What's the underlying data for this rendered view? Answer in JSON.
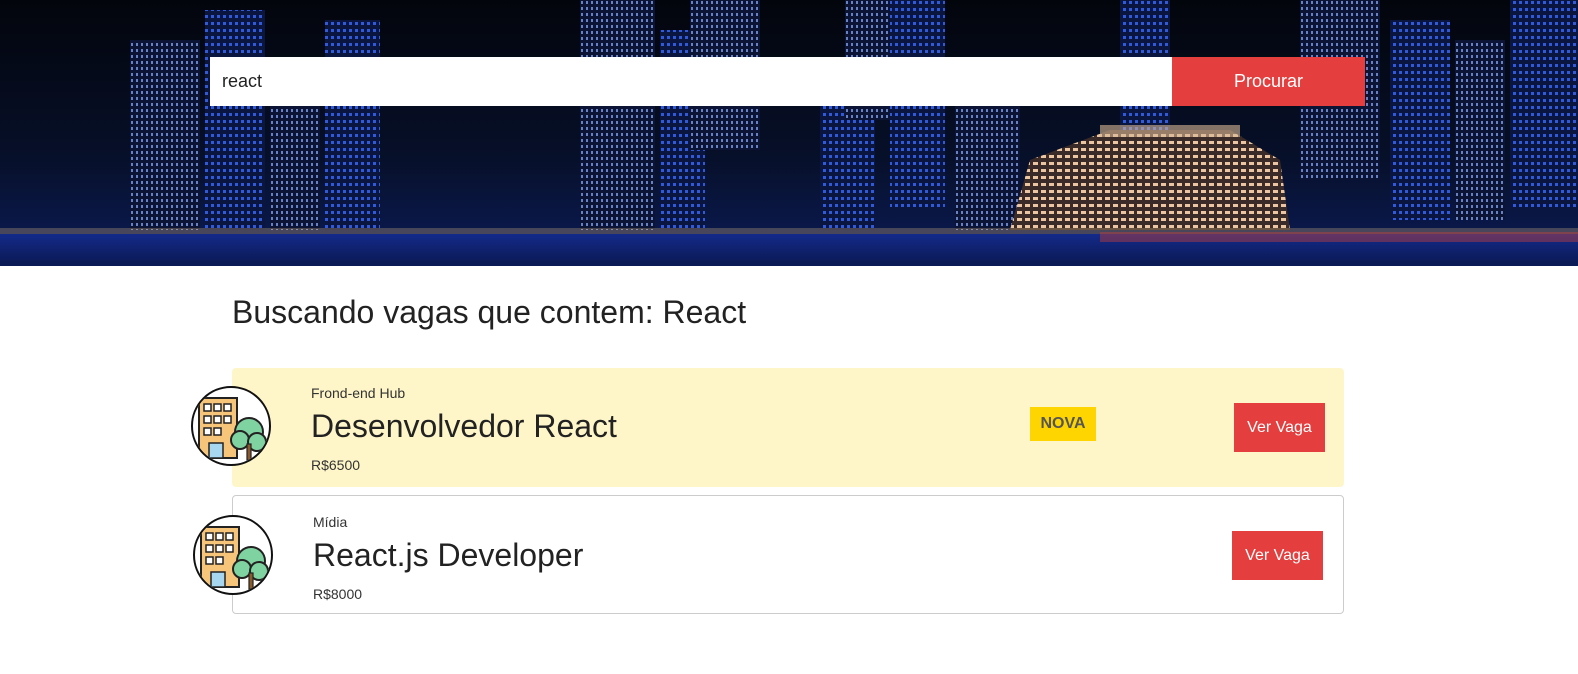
{
  "search": {
    "value": "react",
    "button_label": "Procurar"
  },
  "results": {
    "heading": "Buscando vagas que contem: React"
  },
  "jobs": [
    {
      "company": "Frond-end Hub",
      "title": "Desenvolvedor React",
      "salary": "R$6500",
      "badge": "NOVA",
      "button_label": "Ver Vaga",
      "logo_icon": "office-building-icon"
    },
    {
      "company": "Mídia",
      "title": "React.js Developer",
      "salary": "R$8000",
      "button_label": "Ver Vaga",
      "logo_icon": "office-building-icon"
    }
  ],
  "colors": {
    "accent": "#e53e3e",
    "new_card_bg": "#fef6c8",
    "badge_bg": "#ffd500"
  }
}
